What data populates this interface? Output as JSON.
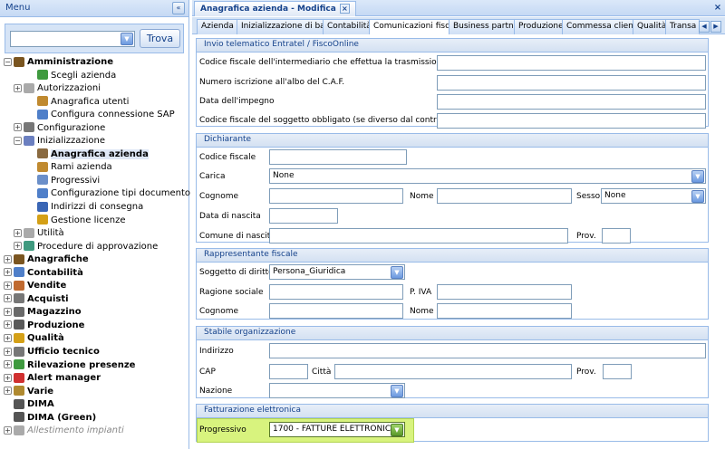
{
  "menu": {
    "title": "Menu",
    "search_button": "Trova",
    "search_value": ""
  },
  "tree": [
    {
      "label": "Amministrazione",
      "level": 0,
      "bold": true,
      "exp": "-",
      "icon": "user-icon",
      "color": "#7a5520"
    },
    {
      "label": "Scegli azienda",
      "level": 2,
      "icon": "grid-icon",
      "color": "#3f9a3f"
    },
    {
      "label": "Autorizzazioni",
      "level": 1,
      "exp": "+",
      "icon": "folder-icon",
      "color": "#aaaaaa"
    },
    {
      "label": "Anagrafica utenti",
      "level": 2,
      "icon": "user-edit-icon",
      "color": "#c08a30"
    },
    {
      "label": "Configura connessione SAP",
      "level": 2,
      "icon": "connection-icon",
      "color": "#4f7fc9"
    },
    {
      "label": "Configurazione",
      "level": 1,
      "exp": "+",
      "icon": "settings-icon",
      "color": "#777777"
    },
    {
      "label": "Inizializzazione",
      "level": 1,
      "exp": "-",
      "icon": "flag-icon",
      "color": "#6b7fc0"
    },
    {
      "label": "Anagrafica azienda",
      "level": 2,
      "bold": true,
      "selected": true,
      "icon": "building-icon",
      "color": "#8a6a40"
    },
    {
      "label": "Rami azienda",
      "level": 2,
      "icon": "hierarchy-icon",
      "color": "#c08a30"
    },
    {
      "label": "Progressivi",
      "level": 2,
      "icon": "table-icon",
      "color": "#6b8fc9"
    },
    {
      "label": "Configurazione tipi documento",
      "level": 2,
      "icon": "document-icon",
      "color": "#4f7fc9"
    },
    {
      "label": "Indirizzi di consegna",
      "level": 2,
      "icon": "address-icon",
      "color": "#3a66b5"
    },
    {
      "label": "Gestione licenze",
      "level": 2,
      "icon": "key-icon",
      "color": "#d4a017"
    },
    {
      "label": "Utilità",
      "level": 1,
      "exp": "+",
      "icon": "folder-icon",
      "color": "#aaaaaa"
    },
    {
      "label": "Procedure di approvazione",
      "level": 1,
      "exp": "+",
      "icon": "approval-icon",
      "color": "#3f9a7f"
    },
    {
      "label": "Anagrafiche",
      "level": 0,
      "bold": true,
      "exp": "+",
      "icon": "pencil-icon",
      "color": "#7a5520"
    },
    {
      "label": "Contabilità",
      "level": 0,
      "bold": true,
      "exp": "+",
      "icon": "ledger-icon",
      "color": "#4f7fc9"
    },
    {
      "label": "Vendite",
      "level": 0,
      "bold": true,
      "exp": "+",
      "icon": "sales-icon",
      "color": "#c06a30"
    },
    {
      "label": "Acquisti",
      "level": 0,
      "bold": true,
      "exp": "+",
      "icon": "cart-icon",
      "color": "#777777"
    },
    {
      "label": "Magazzino",
      "level": 0,
      "bold": true,
      "exp": "+",
      "icon": "warehouse-icon",
      "color": "#6a6a6a"
    },
    {
      "label": "Produzione",
      "level": 0,
      "bold": true,
      "exp": "+",
      "icon": "factory-icon",
      "color": "#5a5a5a"
    },
    {
      "label": "Qualità",
      "level": 0,
      "bold": true,
      "exp": "+",
      "icon": "quality-icon",
      "color": "#d4a017"
    },
    {
      "label": "Ufficio tecnico",
      "level": 0,
      "bold": true,
      "exp": "+",
      "icon": "tools-icon",
      "color": "#777777"
    },
    {
      "label": "Rilevazione presenze",
      "level": 0,
      "bold": true,
      "exp": "+",
      "icon": "clock-icon",
      "color": "#3f9a3f"
    },
    {
      "label": "Alert manager",
      "level": 0,
      "bold": true,
      "exp": "+",
      "icon": "alert-icon",
      "color": "#d03030"
    },
    {
      "label": "Varie",
      "level": 0,
      "bold": true,
      "exp": "+",
      "icon": "misc-icon",
      "color": "#b08a30"
    },
    {
      "label": "DIMA",
      "level": 0,
      "bold": true,
      "icon": "dima-icon",
      "color": "#555555"
    },
    {
      "label": "DIMA (Green)",
      "level": 0,
      "bold": true,
      "icon": "dima-green-icon",
      "color": "#555555"
    },
    {
      "label": "Allestimento impianti",
      "level": 0,
      "gray": true,
      "exp": "+",
      "icon": "plant-icon",
      "color": "#aaaaaa"
    }
  ],
  "doc_tab": "Anagrafica azienda - Modifica",
  "tabs": [
    "Azienda",
    "Inizializzazione di base",
    "Contabilità",
    "Comunicazioni fiscali",
    "Business partner",
    "Produzione",
    "Commessa cliente",
    "Qualità",
    "Transa"
  ],
  "active_tab": 3,
  "sections": {
    "invio": {
      "title": "Invio telematico Entratel / FiscoOnline",
      "f1": "Codice fiscale dell'intermediario che effettua la trasmissione",
      "f2": "Numero iscrizione all'albo del C.A.F.",
      "f3": "Data dell'impegno",
      "f4": "Codice fiscale del soggetto obbligato (se diverso dal contribuente)"
    },
    "dich": {
      "title": "Dichiarante",
      "codfisc": "Codice fiscale",
      "carica": "Carica",
      "carica_val": "None",
      "cognome": "Cognome",
      "nome": "Nome",
      "sesso": "Sesso",
      "sesso_val": "None",
      "data_nascita": "Data di nascita",
      "comune": "Comune di nascita",
      "prov": "Prov."
    },
    "rapp": {
      "title": "Rappresentante fiscale",
      "soggetto": "Soggetto di diritto",
      "soggetto_val": "Persona_Giuridica",
      "ragione": "Ragione sociale",
      "piva": "P. IVA",
      "cognome": "Cognome",
      "nome": "Nome"
    },
    "stab": {
      "title": "Stabile organizzazione",
      "indirizzo": "Indirizzo",
      "cap": "CAP",
      "citta": "Città",
      "prov": "Prov.",
      "nazione": "Nazione"
    },
    "fatt": {
      "title": "Fatturazione elettronica",
      "progressivo": "Progressivo",
      "progressivo_val": "1700 - FATTURE ELETTRONICHE"
    }
  }
}
